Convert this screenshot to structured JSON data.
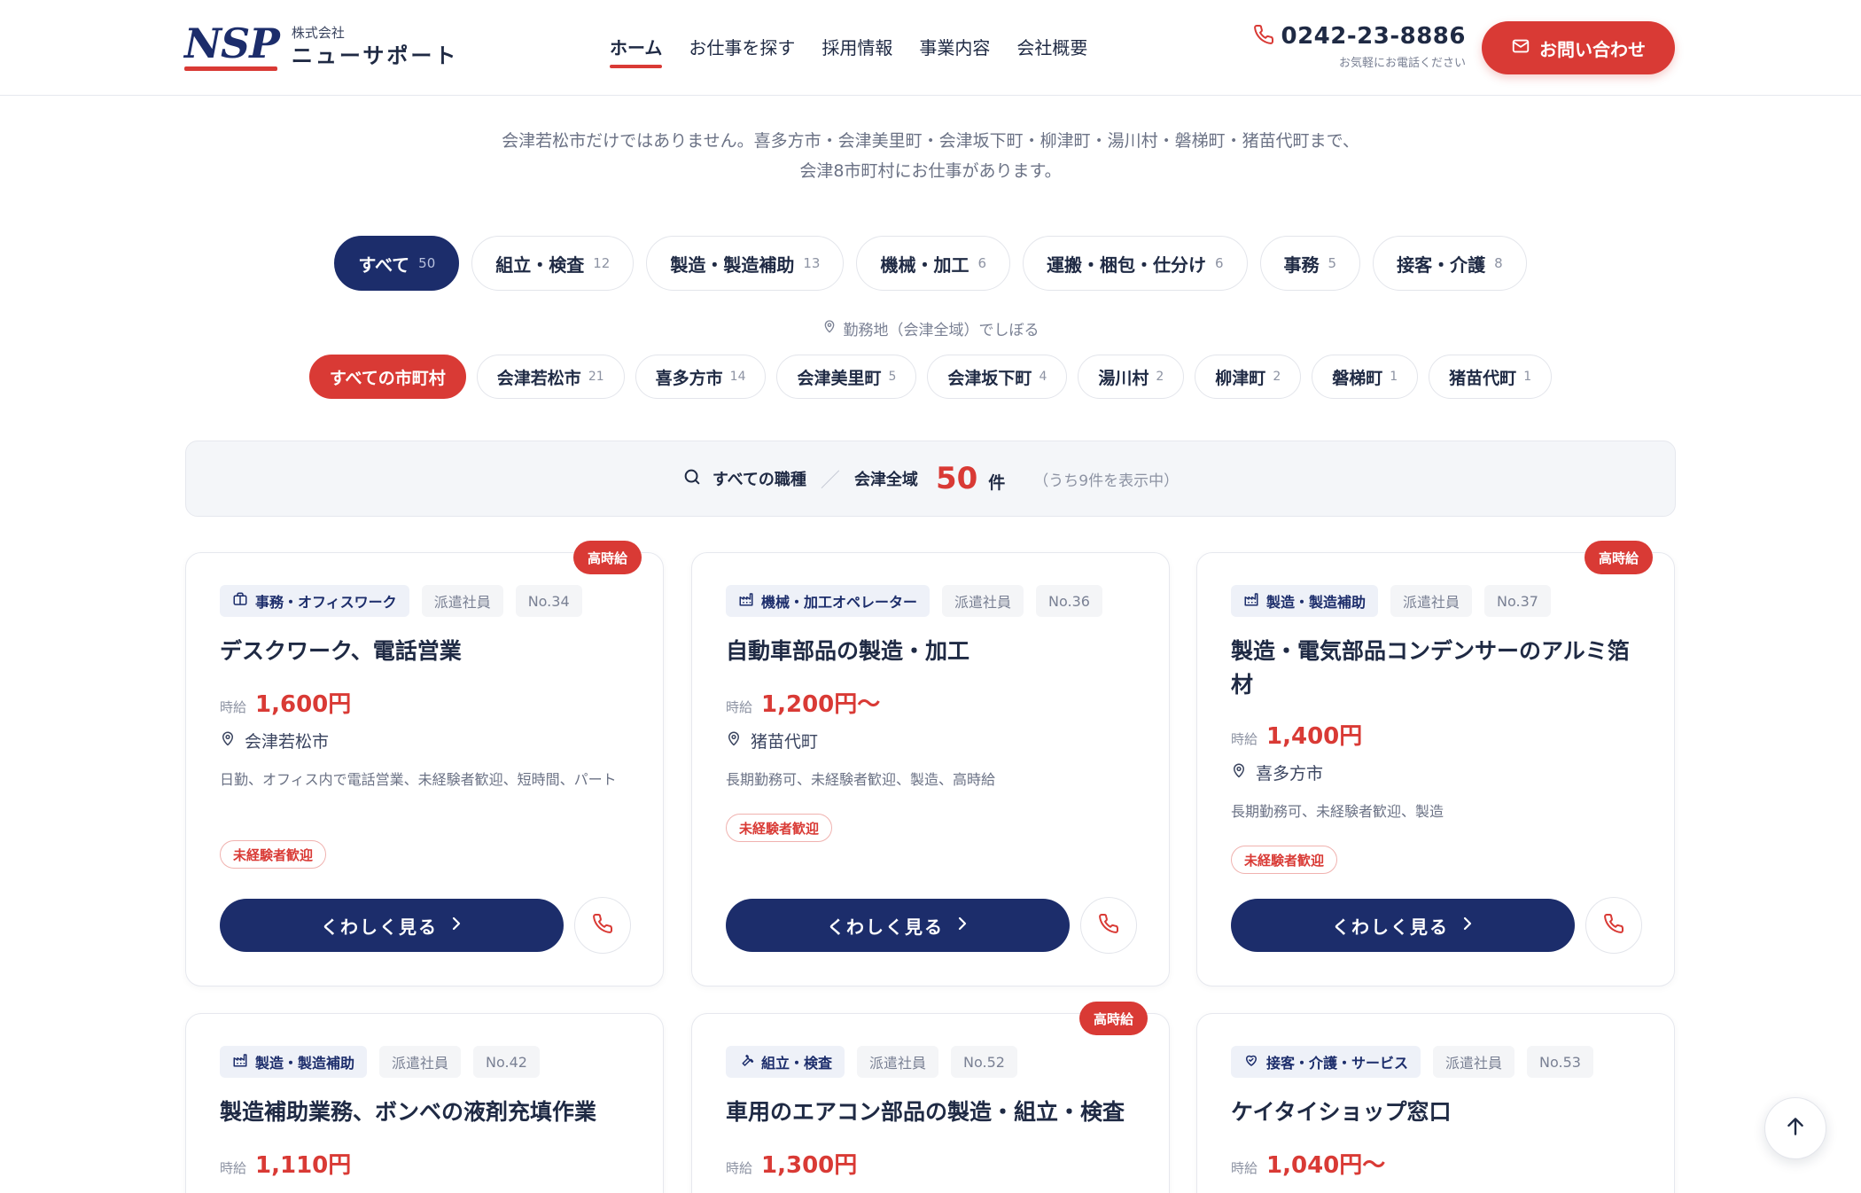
{
  "header": {
    "logo_mark": "NSP",
    "logo_sub": "株式会社",
    "logo_name": "ニューサポート",
    "nav": [
      {
        "label": "ホーム",
        "active": true
      },
      {
        "label": "お仕事を探す"
      },
      {
        "label": "採用情報"
      },
      {
        "label": "事業内容"
      },
      {
        "label": "会社概要"
      }
    ],
    "phone_number": "0242-23-8886",
    "phone_note": "お気軽にお電話ください",
    "contact_label": "お問い合わせ"
  },
  "intro": {
    "line1": "会津若松市だけではありません。喜多方市・会津美里町・会津坂下町・柳津町・湯川村・磐梯町・猪苗代町まで、",
    "line2": "会津8市町村にお仕事があります。"
  },
  "categories": [
    {
      "label": "すべて",
      "count": "50",
      "active": true
    },
    {
      "label": "組立・検査",
      "count": "12"
    },
    {
      "label": "製造・製造補助",
      "count": "13"
    },
    {
      "label": "機械・加工",
      "count": "6"
    },
    {
      "label": "運搬・梱包・仕分け",
      "count": "6"
    },
    {
      "label": "事務",
      "count": "5"
    },
    {
      "label": "接客・介護",
      "count": "8"
    }
  ],
  "area_label": "勤務地（会津全域）でしぼる",
  "municipalities": [
    {
      "label": "すべての市町村",
      "count": "",
      "active": true
    },
    {
      "label": "会津若松市",
      "count": "21"
    },
    {
      "label": "喜多方市",
      "count": "14"
    },
    {
      "label": "会津美里町",
      "count": "5"
    },
    {
      "label": "会津坂下町",
      "count": "4"
    },
    {
      "label": "湯川村",
      "count": "2"
    },
    {
      "label": "柳津町",
      "count": "2"
    },
    {
      "label": "磐梯町",
      "count": "1"
    },
    {
      "label": "猪苗代町",
      "count": "1"
    }
  ],
  "result": {
    "job_type": "すべての職種",
    "area": "会津全域",
    "count": "50",
    "unit": "件",
    "note": "（うち9件を表示中）"
  },
  "cards": [
    {
      "badge": "高時給",
      "category": "事務・オフィスワーク",
      "category_icon": "briefcase-icon",
      "employment": "派遣社員",
      "number": "No.34",
      "title": "デスクワーク、電話営業",
      "wage_label": "時給",
      "wage": "1,600円",
      "location": "会津若松市",
      "description": "日勤、オフィス内で電話営業、未経験者歓迎、短時間、パート",
      "welcome": "未経験者歓迎",
      "detail_label": "くわしく見る"
    },
    {
      "badge": "",
      "category": "機械・加工オペレーター",
      "category_icon": "factory-icon",
      "employment": "派遣社員",
      "number": "No.36",
      "title": "自動車部品の製造・加工",
      "wage_label": "時給",
      "wage": "1,200円〜",
      "location": "猪苗代町",
      "description": "長期勤務可、未経験者歓迎、製造、高時給",
      "welcome": "未経験者歓迎",
      "detail_label": "くわしく見る"
    },
    {
      "badge": "高時給",
      "category": "製造・製造補助",
      "category_icon": "factory-icon",
      "employment": "派遣社員",
      "number": "No.37",
      "title": "製造・電気部品コンデンサーのアルミ箔材",
      "wage_label": "時給",
      "wage": "1,400円",
      "location": "喜多方市",
      "description": "長期勤務可、未経験者歓迎、製造",
      "welcome": "未経験者歓迎",
      "detail_label": "くわしく見る"
    },
    {
      "badge": "",
      "category": "製造・製造補助",
      "category_icon": "factory-icon",
      "employment": "派遣社員",
      "number": "No.42",
      "title": "製造補助業務、ボンベの液剤充填作業",
      "wage_label": "時給",
      "wage": "1,110円"
    },
    {
      "badge": "高時給",
      "category": "組立・検査",
      "category_icon": "wrench-icon",
      "employment": "派遣社員",
      "number": "No.52",
      "title": "車用のエアコン部品の製造・組立・検査",
      "wage_label": "時給",
      "wage": "1,300円"
    },
    {
      "badge": "",
      "category": "接客・介護・サービス",
      "category_icon": "heart-hand-icon",
      "employment": "派遣社員",
      "number": "No.53",
      "title": "ケイタイショップ窓口",
      "wage_label": "時給",
      "wage": "1,040円〜"
    }
  ],
  "colors": {
    "navy": "#1c2d6b",
    "red": "#d93a35",
    "text": "#1f2a44",
    "muted": "#8d93a3"
  }
}
